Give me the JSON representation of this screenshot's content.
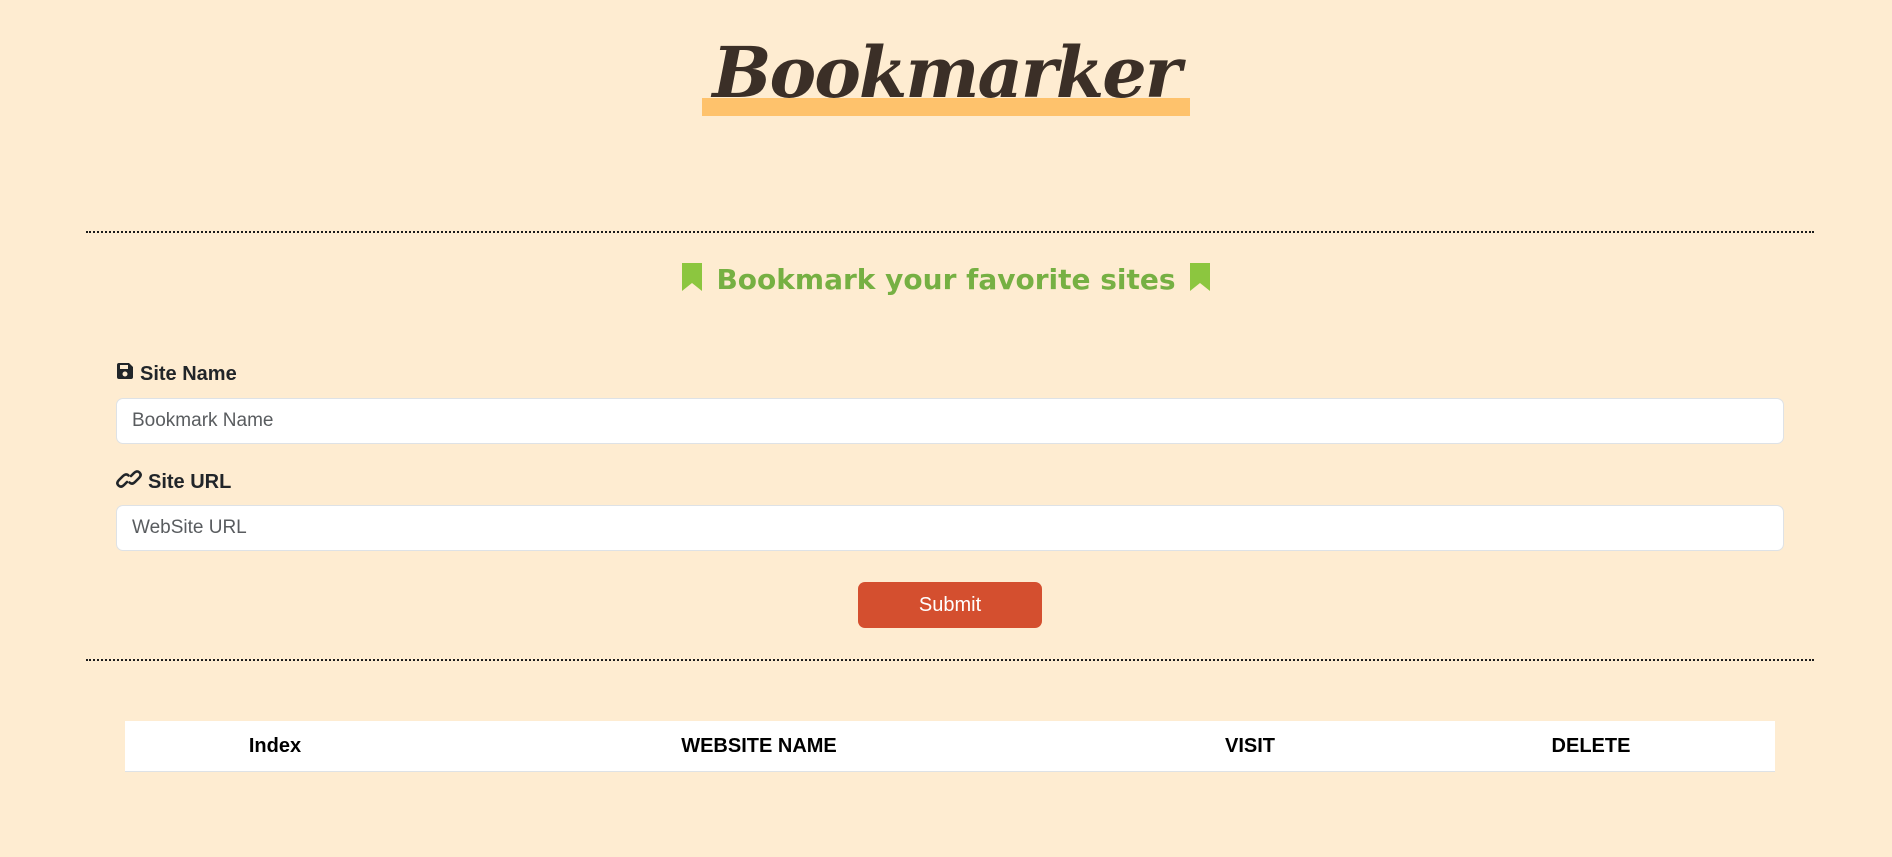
{
  "header": {
    "title": "Bookmarker"
  },
  "form": {
    "subtitle": "Bookmark your favorite sites",
    "site_name": {
      "label": "Site Name",
      "placeholder": "Bookmark Name",
      "value": ""
    },
    "site_url": {
      "label": "Site URL",
      "placeholder": "WebSite URL",
      "value": ""
    },
    "submit_label": "Submit"
  },
  "table": {
    "columns": [
      "Index",
      "WEBSITE NAME",
      "VISIT",
      "DELETE"
    ],
    "rows": []
  },
  "colors": {
    "background": "#feecd1",
    "title_highlight": "#fec26c",
    "subtitle": "#76b043",
    "submit": "#d44f2f"
  },
  "icons": {
    "subtitle_left": "bookmark-icon",
    "subtitle_right": "bookmark-icon",
    "site_name": "floppy-disk-icon",
    "site_url": "link-icon"
  }
}
